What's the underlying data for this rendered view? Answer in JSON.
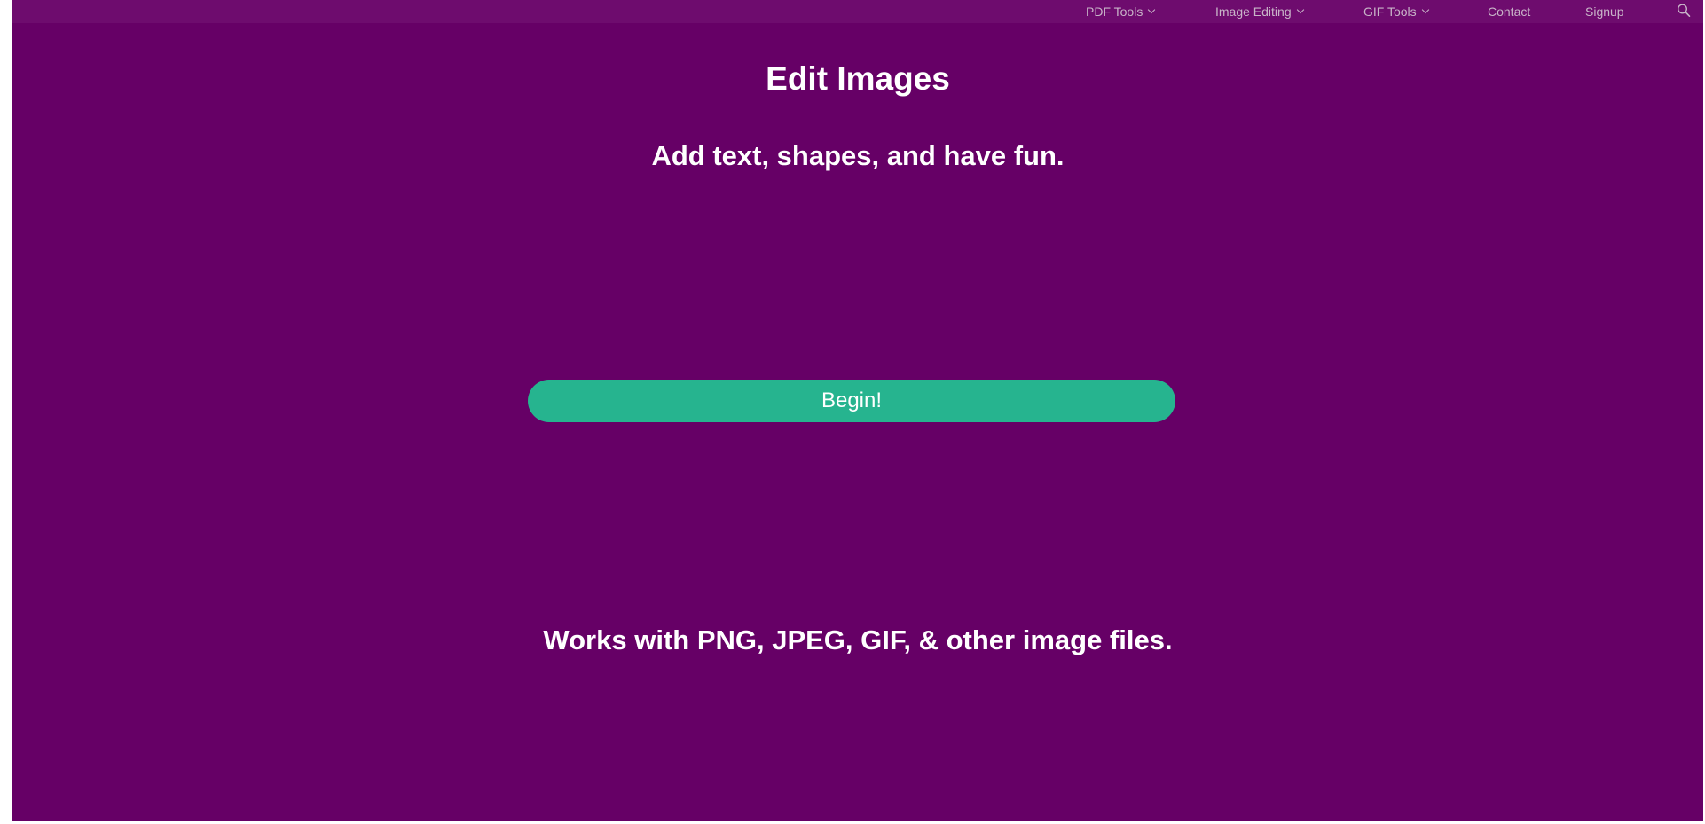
{
  "nav": {
    "items": [
      {
        "label": "PDF Tools",
        "has_dropdown": true
      },
      {
        "label": "Image Editing",
        "has_dropdown": true
      },
      {
        "label": "GIF Tools",
        "has_dropdown": true
      },
      {
        "label": "Contact",
        "has_dropdown": false
      },
      {
        "label": "Signup",
        "has_dropdown": false
      }
    ],
    "search_icon": "search-icon"
  },
  "main": {
    "title": "Edit Images",
    "subtitle": "Add text, shapes, and have fun.",
    "begin_label": "Begin!",
    "formats_note": "Works with PNG, JPEG, GIF, & other image files."
  },
  "colors": {
    "background": "#660066",
    "nav_background": "#6e0c6e",
    "button": "#26b48f",
    "text": "#ffffff"
  }
}
